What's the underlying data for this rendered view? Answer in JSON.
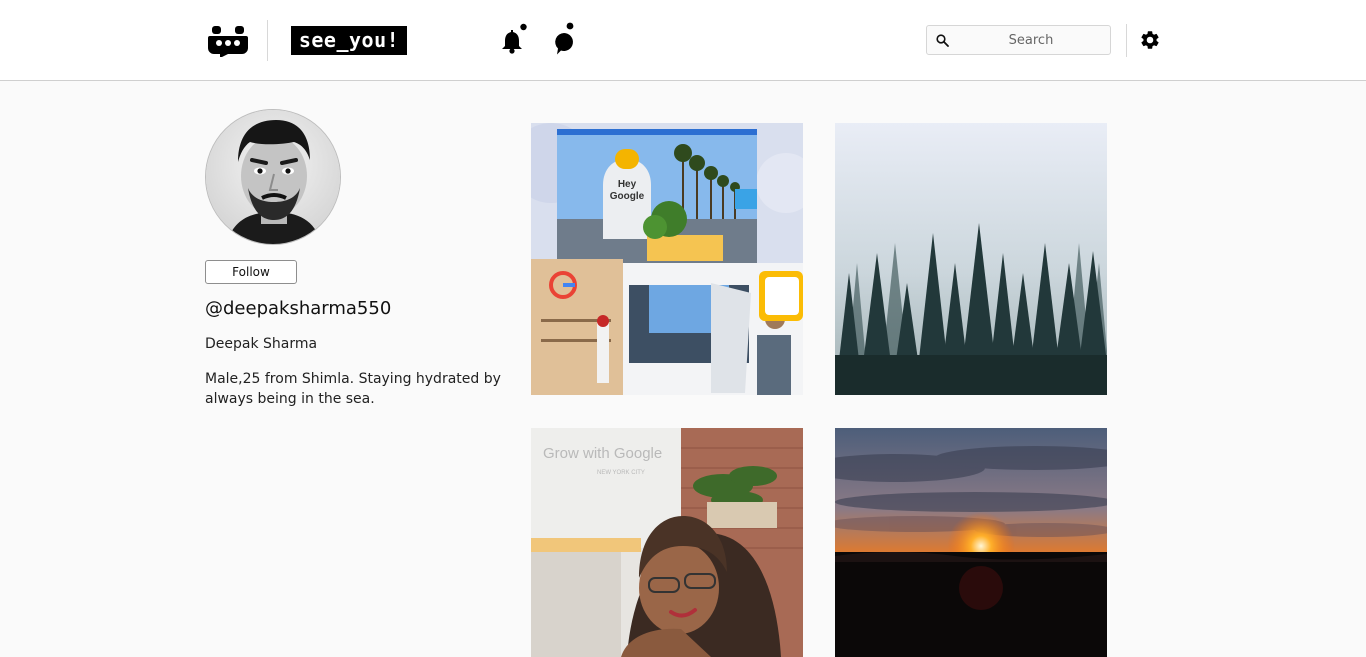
{
  "header": {
    "brand": "see_you!",
    "search": {
      "placeholder": "Search",
      "value": ""
    },
    "icons": [
      "app-logo-icon",
      "notifications-bell-icon",
      "messages-bubble-icon",
      "search-icon",
      "settings-gear-icon"
    ]
  },
  "profile": {
    "follow_label": "Follow",
    "handle": "@deepaksharma550",
    "name": "Deepak Sharma",
    "bio": "Male,25 from Shimla. Staying hydrated by always being in the sea."
  },
  "posts": [
    {
      "id": "post-1",
      "image_text": [
        "Hey",
        "Google"
      ]
    },
    {
      "id": "post-2"
    },
    {
      "id": "post-3",
      "image_text": [
        "Grow with Google",
        "NEW YORK CITY"
      ]
    },
    {
      "id": "post-4"
    }
  ],
  "colors": {
    "header_bg": "#ffffff",
    "page_bg": "#fafafa",
    "brand_bg": "#000000",
    "brand_text": "#ffffff"
  }
}
